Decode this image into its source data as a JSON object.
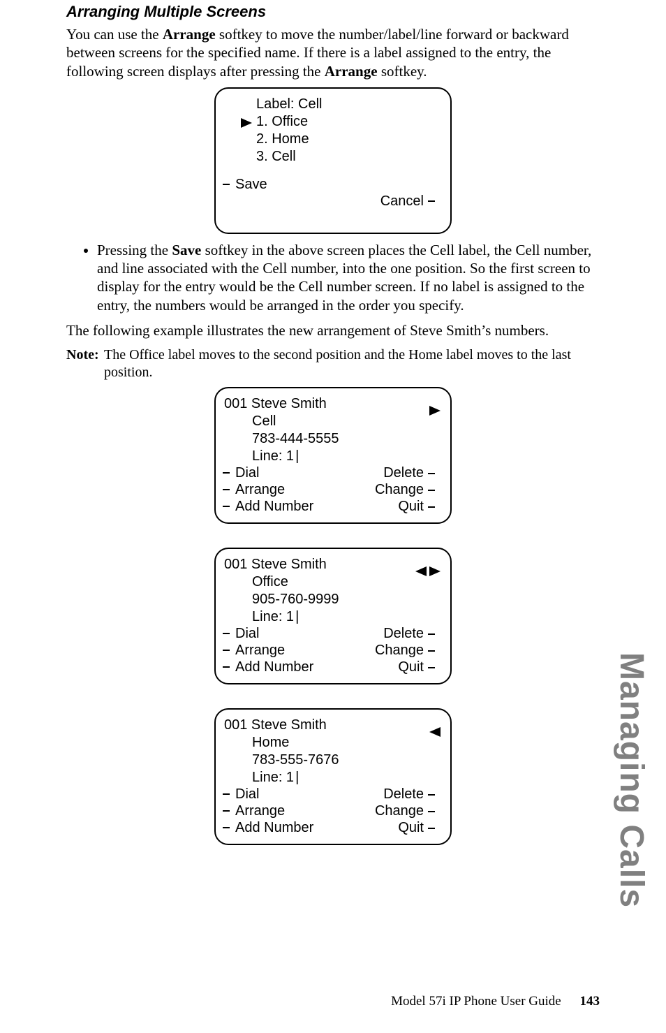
{
  "section_title": "Arranging Multiple Screens",
  "intro_before_bold1": "You can use the ",
  "bold1": "Arrange",
  "intro_mid": " softkey to move the number/label/line forward or backward between screens for the specified name. If there is a label assigned to the entry, the following screen displays after pressing the ",
  "bold2": "Arrange",
  "intro_after": " softkey.",
  "label_screen": {
    "label_line": "Label:  Cell",
    "opt1": "1. Office",
    "opt2": "2. Home",
    "opt3": "3. Cell",
    "save": "Save",
    "cancel": "Cancel"
  },
  "bullet_before": "Pressing the ",
  "bullet_bold": "Save",
  "bullet_after": " softkey in the above screen places the Cell label, the Cell number, and line associated with the Cell number, into the one position. So the first screen to display for the entry would be the Cell number screen. If no label is assigned to the entry, the numbers would be arranged in the order you specify.",
  "follow_para": "The following example illustrates the new arrangement of Steve Smith’s numbers.",
  "note_label": "Note:",
  "note_text": "The Office label moves to the second position and the Home label moves to the last position.",
  "entry_screens": [
    {
      "id": "001  Steve Smith",
      "label": "Cell",
      "number": "783-444-5555",
      "line": "Line: 1",
      "arrow": "right",
      "sk": {
        "dial": "Dial",
        "arrange": "Arrange",
        "add": "Add Number",
        "del": "Delete",
        "chg": "Change",
        "quit": "Quit"
      }
    },
    {
      "id": "001  Steve Smith",
      "label": "Office",
      "number": "905-760-9999",
      "line": "Line: 1",
      "arrow": "both",
      "sk": {
        "dial": "Dial",
        "arrange": "Arrange",
        "add": "Add Number",
        "del": "Delete",
        "chg": "Change",
        "quit": "Quit"
      }
    },
    {
      "id": "001  Steve Smith",
      "label": "Home",
      "number": "783-555-7676",
      "line": "Line: 1",
      "arrow": "left",
      "sk": {
        "dial": "Dial",
        "arrange": "Arrange",
        "add": "Add Number",
        "del": "Delete",
        "chg": "Change",
        "quit": "Quit"
      }
    }
  ],
  "side_text": "Managing Calls",
  "footer_text": "Model 57i IP Phone User Guide",
  "page_num": "143"
}
